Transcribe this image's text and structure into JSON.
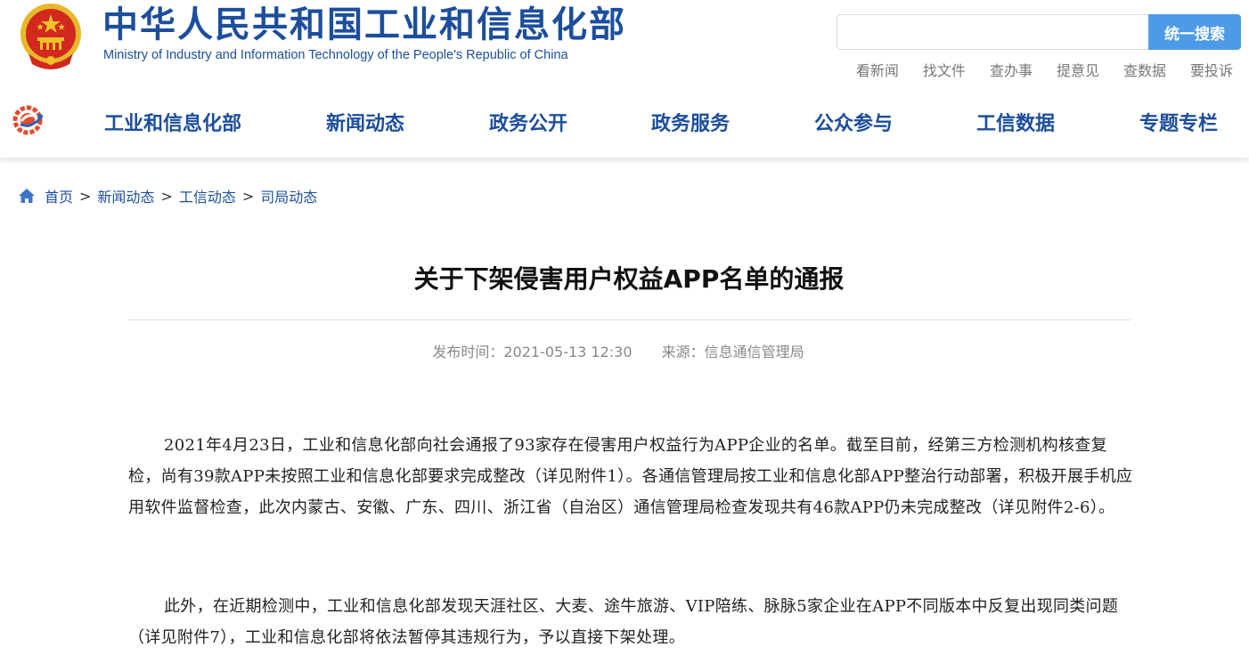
{
  "header": {
    "site_title": "中华人民共和国工业和信息化部",
    "site_subtitle": "Ministry of Industry and Information Technology of the People's Republic of China",
    "emblem_icon": "national-emblem-icon",
    "search": {
      "placeholder": "",
      "value": "",
      "button_label": "统一搜索"
    },
    "quick_links": [
      "看新闻",
      "找文件",
      "查办事",
      "提意见",
      "查数据",
      "要投诉"
    ]
  },
  "nav": {
    "logo_icon": "ministry-logo-icon",
    "items": [
      "工业和信息化部",
      "新闻动态",
      "政务公开",
      "政务服务",
      "公众参与",
      "工信数据",
      "专题专栏"
    ]
  },
  "breadcrumb": {
    "home_icon": "home-icon",
    "items": [
      "首页",
      "新闻动态",
      "工信动态",
      "司局动态"
    ],
    "separator": ">"
  },
  "article": {
    "title": "关于下架侵害用户权益APP名单的通报",
    "publish_time": "发布时间：2021-05-13 12:30",
    "source": "来源：信息通信管理局",
    "paragraphs": [
      "2021年4月23日，工业和信息化部向社会通报了93家存在侵害用户权益行为APP企业的名单。截至目前，经第三方检测机构核查复检，尚有39款APP未按照工业和信息化部要求完成整改（详见附件1）。各通信管理局按工业和信息化部APP整治行动部署，积极开展手机应用软件监督检查，此次内蒙古、安徽、广东、四川、浙江省（自治区）通信管理局检查发现共有46款APP仍未完成整改（详见附件2-6）。",
      "此外，在近期检测中，工业和信息化部发现天涯社区、大麦、途牛旅游、VIP陪练、脉脉5家企业在APP不同版本中反复出现同类问题（详见附件7），工业和信息化部将依法暂停其违规行为，予以直接下架处理。"
    ]
  },
  "colors": {
    "brand_blue": "#1c4e9c",
    "search_button": "#4d9be6",
    "emblem_red": "#d2281e",
    "emblem_gold": "#f3c12b"
  }
}
